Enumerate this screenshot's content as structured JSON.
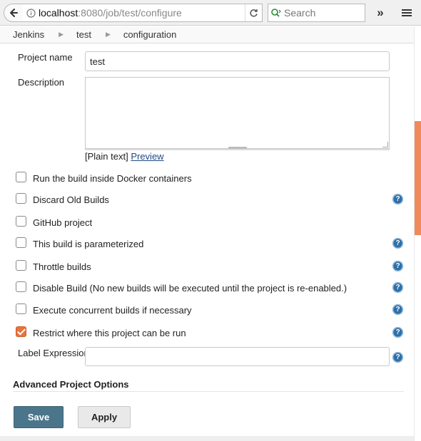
{
  "browser": {
    "url_host": "localhost",
    "url_rest": ":8080/job/test/configure",
    "search_placeholder": "Search"
  },
  "breadcrumb": [
    {
      "label": "Jenkins"
    },
    {
      "label": "test"
    },
    {
      "label": "configuration"
    }
  ],
  "form": {
    "project_name_label": "Project name",
    "project_name_value": "test",
    "description_label": "Description",
    "description_value": "",
    "plain_text": "[Plain text]",
    "preview_link": "Preview",
    "label_expression_label": "Label Expression",
    "label_expression_value": ""
  },
  "options": [
    {
      "label": "Run the build inside Docker containers",
      "checked": false,
      "help": false
    },
    {
      "label": "Discard Old Builds",
      "checked": false,
      "help": true
    },
    {
      "label": "GitHub project",
      "checked": false,
      "help": false
    },
    {
      "label": "This build is parameterized",
      "checked": false,
      "help": true
    },
    {
      "label": "Throttle builds",
      "checked": false,
      "help": true
    },
    {
      "label": "Disable Build (No new builds will be executed until the project is re-enabled.)",
      "checked": false,
      "help": true
    },
    {
      "label": "Execute concurrent builds if necessary",
      "checked": false,
      "help": true
    },
    {
      "label": "Restrict where this project can be run",
      "checked": true,
      "help": true
    }
  ],
  "advanced": {
    "title": "Advanced Project Options"
  },
  "actions": {
    "save_label": "Save",
    "apply_label": "Apply"
  },
  "colors": {
    "accent": "#e8743b",
    "save_button": "#4b758b",
    "help_icon": "#2e6fa7",
    "link": "#204a87"
  },
  "icons": {
    "back": "back-arrow-icon",
    "info": "info-icon",
    "reload": "reload-icon",
    "search": "search-icon",
    "overflow": "chevron-double-right-icon",
    "menu": "hamburger-menu-icon",
    "help": "help-icon",
    "separator": "breadcrumb-arrow-icon"
  }
}
